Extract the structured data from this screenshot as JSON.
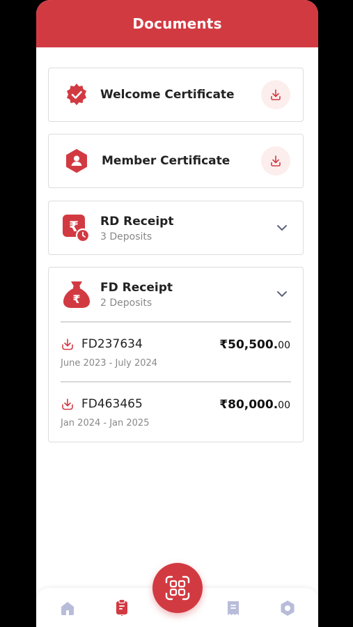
{
  "header": {
    "title": "Documents"
  },
  "documents": {
    "welcome": {
      "label": "Welcome Certificate",
      "icon": "verified-badge-icon"
    },
    "member": {
      "label": "Member Certificate",
      "icon": "member-hexagon-icon"
    }
  },
  "receipts": {
    "rd": {
      "title": "RD Receipt",
      "subtitle": "3 Deposits",
      "icon": "rupee-clock-icon"
    },
    "fd": {
      "title": "FD Receipt",
      "subtitle": "2 Deposits",
      "icon": "money-bag-icon",
      "deposits": [
        {
          "id": "FD237634",
          "period": "June 2023 - July 2024",
          "amount_main": "₹50,500.",
          "amount_paise": "00"
        },
        {
          "id": "FD463465",
          "period": "Jan 2024 - Jan 2025",
          "amount_main": "₹80,000.",
          "amount_paise": "00"
        }
      ]
    }
  },
  "nav": {
    "items": [
      "home-icon",
      "clipboard-icon",
      "scan-icon",
      "receipt-icon",
      "settings-icon"
    ],
    "active": "clipboard-icon"
  },
  "colors": {
    "accent": "#d23a42",
    "nav_inactive": "#b9bcd9"
  }
}
